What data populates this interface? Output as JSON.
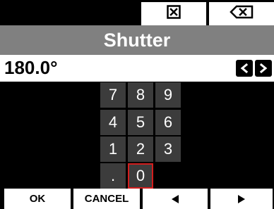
{
  "toolbar": {
    "clear_icon": "close-box-icon",
    "backspace_icon": "backspace-icon"
  },
  "header": {
    "title": "Shutter"
  },
  "value": {
    "text": "180.0°",
    "left_arrow": "<",
    "right_arrow": ">"
  },
  "keypad": {
    "keys": [
      "7",
      "8",
      "9",
      "4",
      "5",
      "6",
      "1",
      "2",
      "3",
      ".",
      "0"
    ],
    "selected": "0"
  },
  "footer": {
    "ok_label": "OK",
    "cancel_label": "CANCEL",
    "prev_icon": "triangle-left-icon",
    "next_icon": "triangle-right-icon"
  },
  "colors": {
    "title_bar": "#808080",
    "key_background": "#3c3c3c",
    "selected_border": "#d21e1e"
  }
}
